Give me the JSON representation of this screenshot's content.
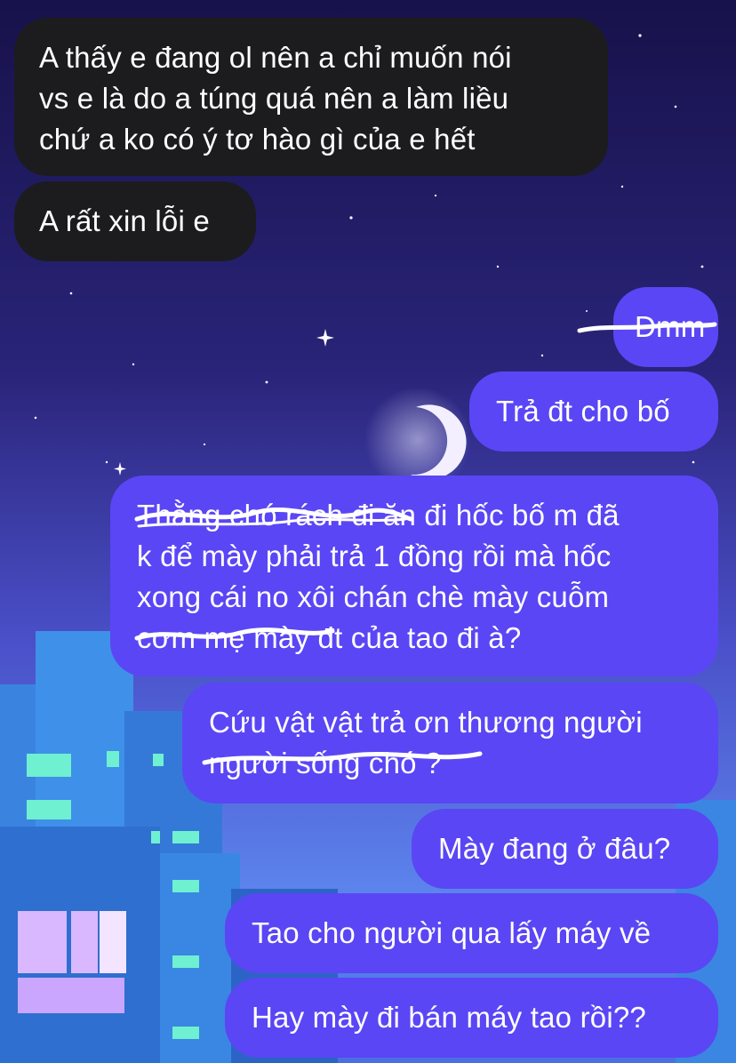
{
  "theme": {
    "incoming_bubble": "#1c1c1e",
    "outgoing_bubble": "#5a46f5",
    "text": "#ffffff",
    "sky_top": "#1a1550",
    "sky_bottom": "#5b7bf0",
    "city": "#3f8fe6"
  },
  "messages": [
    {
      "id": "m1",
      "direction": "incoming",
      "lines": [
        "A thấy e đang ol nên a chỉ muốn nói",
        "vs e là do a túng quá nên a làm liều",
        "chứ a ko có ý tơ hào gì của e hết"
      ]
    },
    {
      "id": "m2",
      "direction": "incoming",
      "lines": [
        "A rất xin lỗi e"
      ]
    },
    {
      "id": "m3",
      "direction": "outgoing",
      "lines": [
        "Đmm"
      ],
      "scribbled_out": true
    },
    {
      "id": "m4",
      "direction": "outgoing",
      "lines": [
        "Trả đt cho bố"
      ]
    },
    {
      "id": "m5",
      "direction": "outgoing",
      "lines": [
        "Thằng chó rách đi ăn đi hốc bố m đã",
        "k để mày phải trả 1 đồng rồi mà hốc",
        "xong cái no xôi chán chè mày cuỗm",
        "cơm mẹ mày đt của tao đi à?"
      ],
      "scribbled_out_parts": [
        "Thằng chó rách đi",
        "cơm mẹ mày"
      ]
    },
    {
      "id": "m6",
      "direction": "outgoing",
      "lines": [
        "Cứu vật vật trả ơn thương người",
        "người sống chó ?"
      ],
      "scribbled_out_parts": [
        "người sống chó ?"
      ]
    },
    {
      "id": "m7",
      "direction": "outgoing",
      "lines": [
        "Mày đang ở đâu?"
      ]
    },
    {
      "id": "m8",
      "direction": "outgoing",
      "lines": [
        "Tao cho người qua lấy máy về"
      ]
    },
    {
      "id": "m9",
      "direction": "outgoing",
      "lines": [
        "Hay mày đi bán máy tao rồi??"
      ]
    }
  ]
}
